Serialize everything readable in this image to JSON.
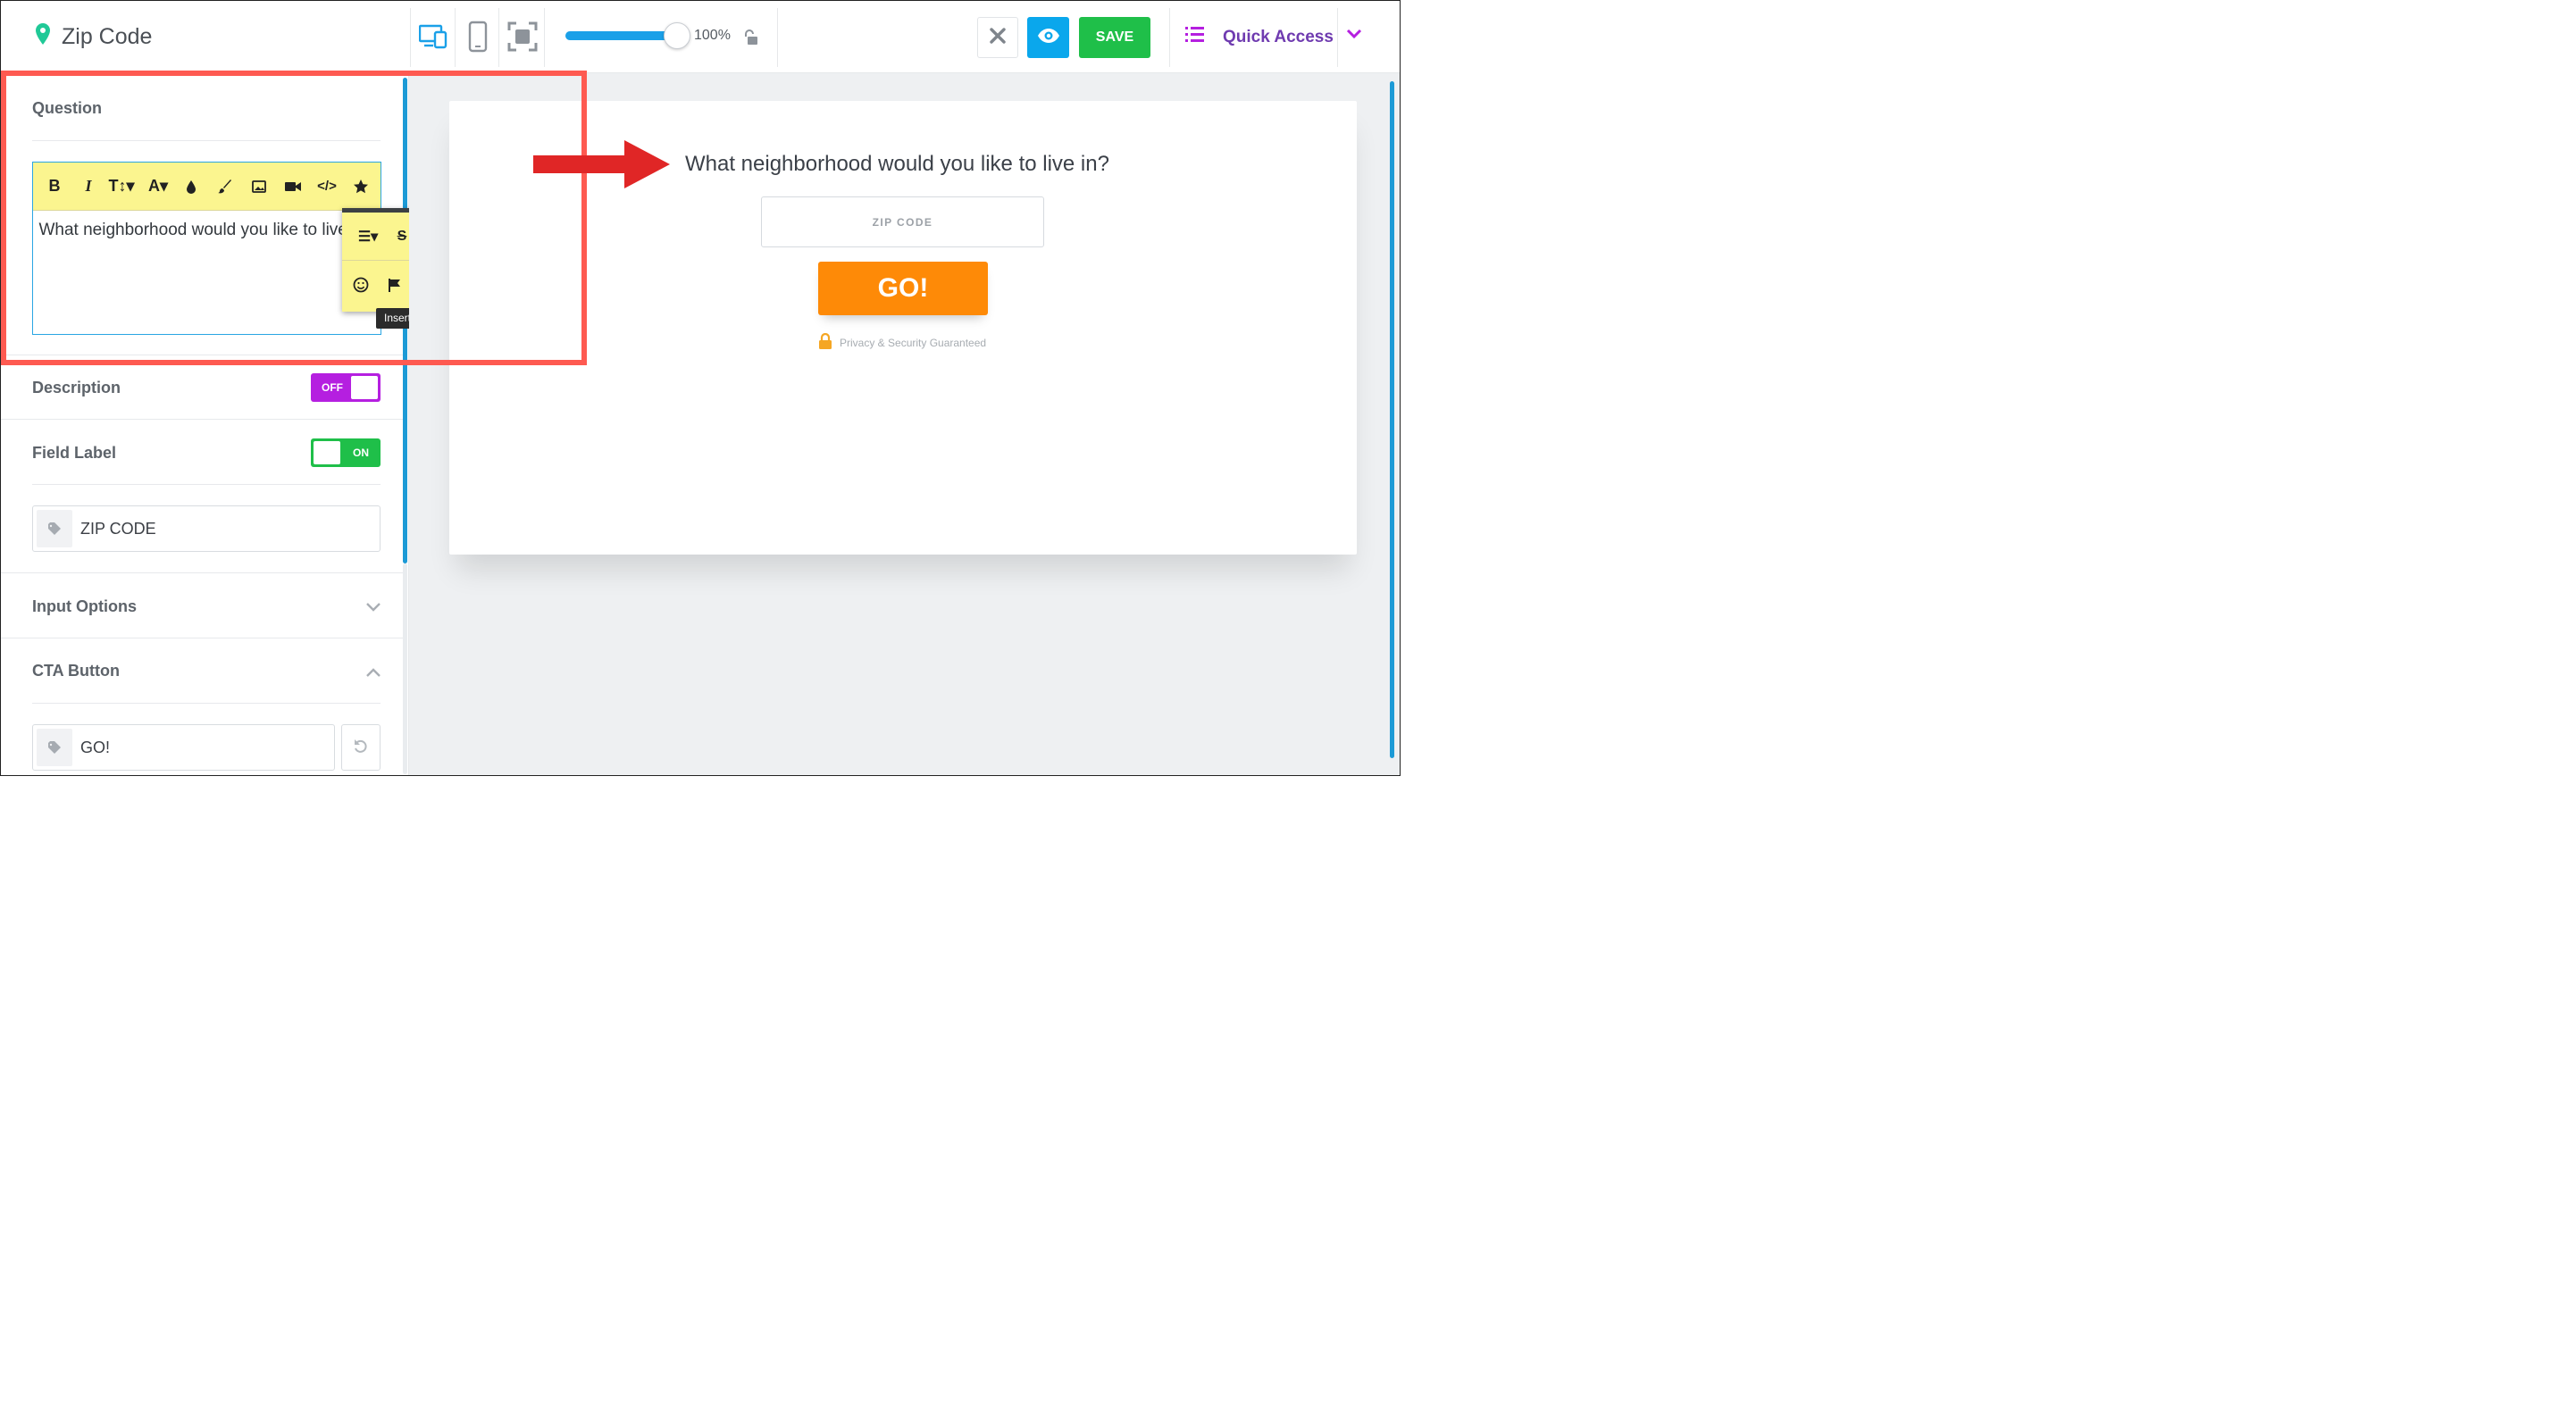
{
  "header": {
    "title": "Zip Code",
    "zoom": "100%",
    "save_label": "SAVE",
    "quick_access": "Quick Access"
  },
  "panel": {
    "question_title": "Question",
    "question_text": "What neighborhood would you like to live in?",
    "tooltip": "Insert Click-to-Call",
    "description_title": "Description",
    "description_toggle": "OFF",
    "field_label_title": "Field Label",
    "field_label_toggle": "ON",
    "field_label_value": "ZIP CODE",
    "input_options_title": "Input Options",
    "cta_title": "CTA Button",
    "cta_value": "GO!"
  },
  "preview": {
    "question": "What neighborhood would you like to live in?",
    "zip_placeholder": "ZIP CODE",
    "button": "GO!",
    "privacy": "Privacy & Security Guaranteed"
  },
  "colors": {
    "accent_blue": "#0aa7ec",
    "save_green": "#1fbf49",
    "toggle_purple": "#b51fe0",
    "cta_orange": "#fe8a07",
    "annotation_red": "#fe5a51",
    "editor_yellow": "#fbf58f"
  }
}
